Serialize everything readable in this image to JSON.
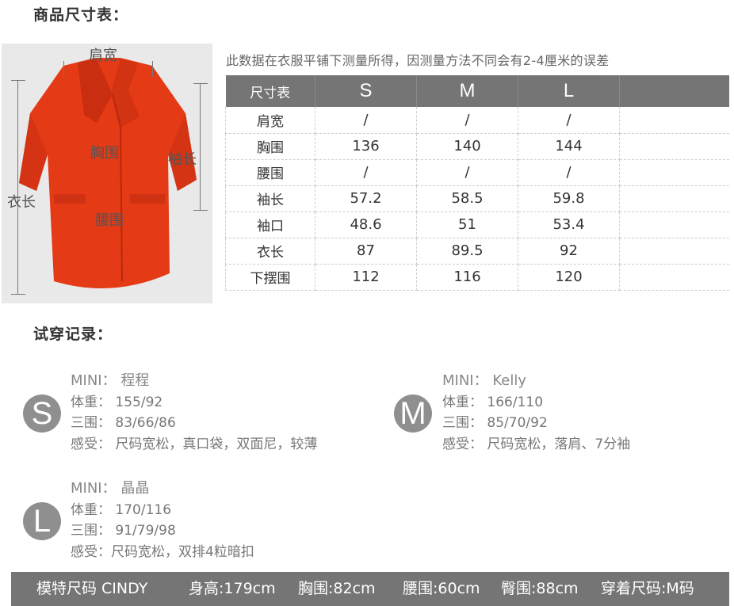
{
  "section_size_title": "商品尺寸表：",
  "section_tryon_title": "试穿记录：",
  "measure_note": "此数据在衣服平铺下测量所得，因测量方法不同会有2-4厘米的误差",
  "photo_labels": {
    "shoulder": "肩宽",
    "chest": "胸围",
    "sleeve": "袖长",
    "length": "衣长",
    "waist": "腰围"
  },
  "size_table": {
    "header": [
      "尺寸表",
      "S",
      "M",
      "L",
      ""
    ],
    "rows": [
      [
        "肩宽",
        "/",
        "/",
        "/",
        ""
      ],
      [
        "胸围",
        "136",
        "140",
        "144",
        ""
      ],
      [
        "腰围",
        "/",
        "/",
        "/",
        ""
      ],
      [
        "袖长",
        "57.2",
        "58.5",
        "59.8",
        ""
      ],
      [
        "袖口",
        "48.6",
        "51",
        "53.4",
        ""
      ],
      [
        "衣长",
        "87",
        "89.5",
        "92",
        ""
      ],
      [
        "下摆围",
        "112",
        "116",
        "120",
        ""
      ]
    ]
  },
  "tryon": [
    {
      "size": "S",
      "name_line": "MINI： 程程",
      "weight": "体重： 155/92",
      "measurements": "三围： 83/66/86",
      "feeling": "感受： 尺码宽松，真口袋，双面尼，较薄"
    },
    {
      "size": "M",
      "name_line": "MINI： Kelly",
      "weight": "体重： 166/110",
      "measurements": "三围： 85/70/92",
      "feeling": "感受： 尺码宽松，落肩、7分袖"
    },
    {
      "size": "L",
      "name_line": "MINI： 晶晶",
      "weight": "体重： 170/116",
      "measurements": "三围： 91/79/98",
      "feeling": "感受：尺码宽松，双排4粒暗扣"
    }
  ],
  "footer": {
    "model": "模特尺码 CINDY",
    "height": "身高:179cm",
    "chest": "胸围:82cm",
    "waist": "腰围:60cm",
    "hip": "臀围:88cm",
    "size": "穿着尺码:M码"
  },
  "colors": {
    "coat": "#e43a16",
    "header_bg": "#757575",
    "badge": "#8f8f8f"
  }
}
